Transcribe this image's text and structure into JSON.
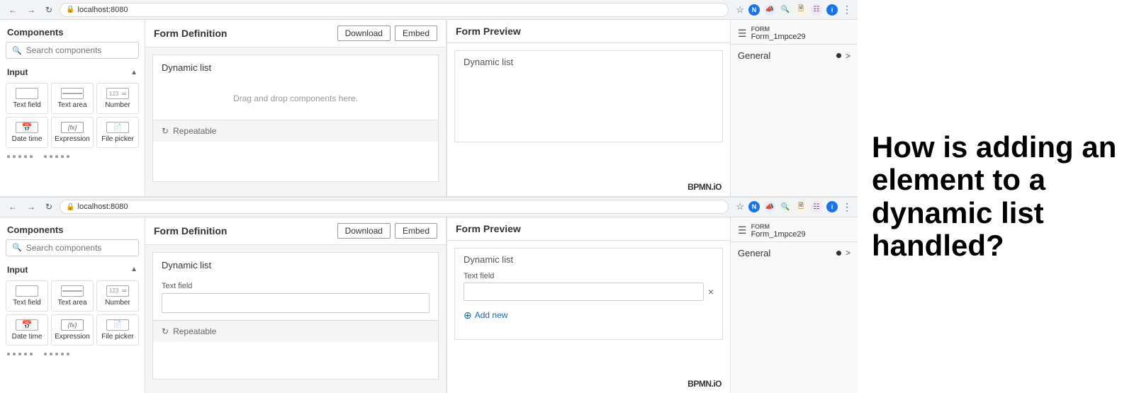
{
  "browser1": {
    "url": "localhost:8080",
    "back_enabled": false,
    "forward_enabled": false
  },
  "browser2": {
    "url": "localhost:8080"
  },
  "sidebar": {
    "header": "Components",
    "search_placeholder": "Search components",
    "input_section": "Input",
    "components": [
      {
        "id": "text-field",
        "label": "Text field"
      },
      {
        "id": "text-area",
        "label": "Text area"
      },
      {
        "id": "number",
        "label": "Number"
      },
      {
        "id": "date-time",
        "label": "Date time"
      },
      {
        "id": "expression",
        "label": "Expression"
      },
      {
        "id": "file-picker",
        "label": "File picker"
      }
    ]
  },
  "top_screenshot": {
    "form_definition": {
      "title": "Form Definition",
      "download_label": "Download",
      "embed_label": "Embed",
      "group_label": "Dynamic list",
      "drop_hint": "Drag and drop components here.",
      "repeatable_label": "Repeatable"
    },
    "form_preview": {
      "title": "Form Preview",
      "group_label": "Dynamic list"
    }
  },
  "bottom_screenshot": {
    "form_definition": {
      "title": "Form Definition",
      "download_label": "Download",
      "embed_label": "Embed",
      "group_label": "Dynamic list",
      "field_label": "Text field",
      "repeatable_label": "Repeatable"
    },
    "form_preview": {
      "title": "Form Preview",
      "group_label": "Dynamic list",
      "field_label": "Text field",
      "add_new_label": "Add new",
      "delete_icon": "×"
    }
  },
  "properties_panel": {
    "form_label": "FORM",
    "form_id": "Form_1mpce29",
    "section_general": "General"
  },
  "bpmn_logo": "BPMN.iO",
  "question": "How is adding an element to a dynamic list handled?"
}
